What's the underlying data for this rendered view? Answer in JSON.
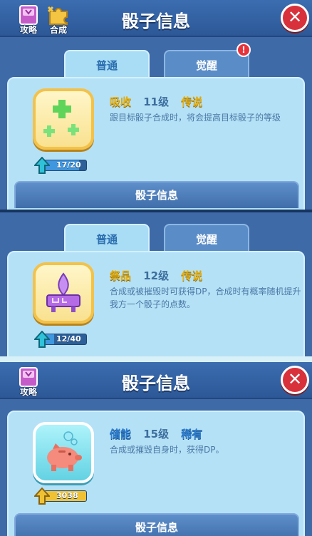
{
  "screen1": {
    "title": "骰子信息",
    "tools": [
      {
        "label": "攻略",
        "icon": "book-icon"
      },
      {
        "label": "合成",
        "icon": "puzzle-icon"
      }
    ],
    "close_label": "✕",
    "tabs": [
      {
        "label": "普通",
        "active": true
      },
      {
        "label": "觉醒",
        "active": false,
        "badge": "!"
      }
    ],
    "dice": {
      "name": "吸收",
      "level": "11级",
      "rarity": "传说",
      "description": "跟目标骰子合成时，将会提高目标骰子的等级",
      "count": "17/20",
      "progress": 0.85,
      "icon": "green-plus-dice-icon"
    },
    "info_button": "骰子信息"
  },
  "screen2": {
    "tabs": [
      {
        "label": "普通",
        "active": true
      },
      {
        "label": "觉醒",
        "active": false
      }
    ],
    "dice": {
      "name": "祭品",
      "level": "12级",
      "rarity": "传说",
      "description": "合成或被摧毁时可获得DP，合成时有概率随机提升我方一个骰子的点数。",
      "count": "12/40",
      "progress": 0.3,
      "icon": "altar-flame-dice-icon"
    }
  },
  "screen3": {
    "title": "骰子信息",
    "tools": [
      {
        "label": "攻略",
        "icon": "book-icon"
      }
    ],
    "close_label": "✕",
    "dice": {
      "name": "储能",
      "level": "15级",
      "rarity": "稀有",
      "description": "合成或摧毁自身时，获得DP。",
      "count": "3038",
      "progress": 1.0,
      "icon": "piggy-bank-dice-icon"
    },
    "info_button": "骰子信息"
  },
  "colors": {
    "legend_gold": "#e6b114",
    "rare_blue": "#2f7fd0",
    "close_red": "#d9313b"
  }
}
